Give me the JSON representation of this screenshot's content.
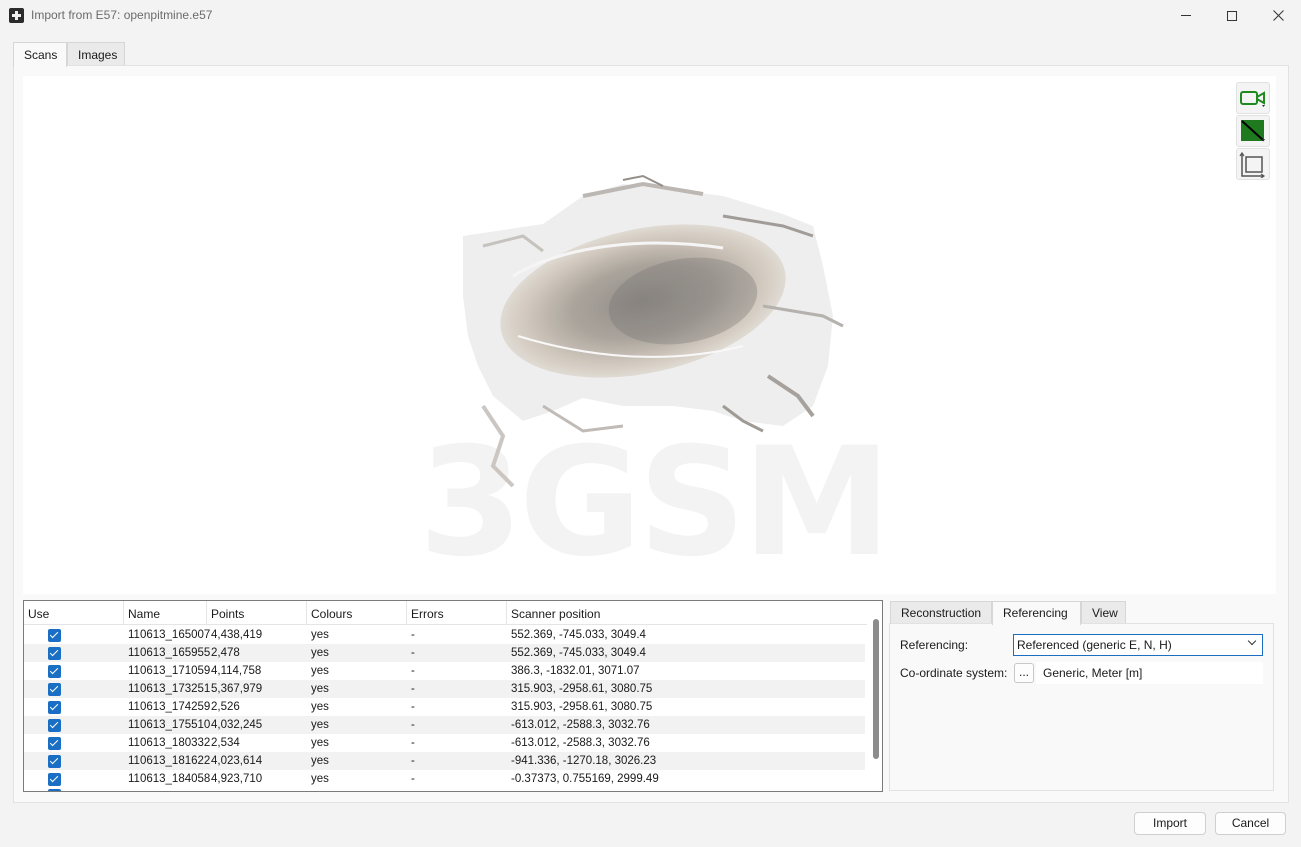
{
  "window": {
    "title": "Import from E57: openpitmine.e57"
  },
  "tabs": [
    {
      "label": "Scans",
      "active": true
    },
    {
      "label": "Images",
      "active": false
    }
  ],
  "viewport": {
    "watermark": "3GSM",
    "tools": [
      "camera-view-icon",
      "colour-mode-icon",
      "frame-view-icon"
    ],
    "tool_color": "#1f8a1f"
  },
  "scan_table": {
    "columns": [
      "Use",
      "Name",
      "Points",
      "Colours",
      "Errors",
      "Scanner position"
    ],
    "rows": [
      {
        "use": true,
        "name": "110613_165007",
        "points": "4,438,419",
        "colours": "yes",
        "errors": "-",
        "position": "552.369, -745.033, 3049.4"
      },
      {
        "use": true,
        "name": "110613_165955",
        "points": "2,478",
        "colours": "yes",
        "errors": "-",
        "position": "552.369, -745.033, 3049.4"
      },
      {
        "use": true,
        "name": "110613_171059",
        "points": "4,114,758",
        "colours": "yes",
        "errors": "-",
        "position": "386.3, -1832.01, 3071.07"
      },
      {
        "use": true,
        "name": "110613_173251",
        "points": "5,367,979",
        "colours": "yes",
        "errors": "-",
        "position": "315.903, -2958.61, 3080.75"
      },
      {
        "use": true,
        "name": "110613_174259",
        "points": "2,526",
        "colours": "yes",
        "errors": "-",
        "position": "315.903, -2958.61, 3080.75"
      },
      {
        "use": true,
        "name": "110613_175510",
        "points": "4,032,245",
        "colours": "yes",
        "errors": "-",
        "position": "-613.012, -2588.3, 3032.76"
      },
      {
        "use": true,
        "name": "110613_180332",
        "points": "2,534",
        "colours": "yes",
        "errors": "-",
        "position": "-613.012, -2588.3, 3032.76"
      },
      {
        "use": true,
        "name": "110613_181622",
        "points": "4,023,614",
        "colours": "yes",
        "errors": "-",
        "position": "-941.336, -1270.18, 3026.23"
      },
      {
        "use": true,
        "name": "110613_184058",
        "points": "4,923,710",
        "colours": "yes",
        "errors": "-",
        "position": "-0.37373, 0.755169, 2999.49"
      }
    ]
  },
  "side_tabs": [
    {
      "label": "Reconstruction",
      "active": false
    },
    {
      "label": "Referencing",
      "active": true
    },
    {
      "label": "View",
      "active": false
    }
  ],
  "referencing": {
    "label": "Referencing:",
    "selected": "Referenced (generic E, N, H)",
    "coord_label": "Co-ordinate system:",
    "coord_button": "...",
    "coord_value": "Generic, Meter [m]"
  },
  "buttons": {
    "import": "Import",
    "cancel": "Cancel"
  },
  "colors": {
    "accent": "#1a6fc4"
  }
}
